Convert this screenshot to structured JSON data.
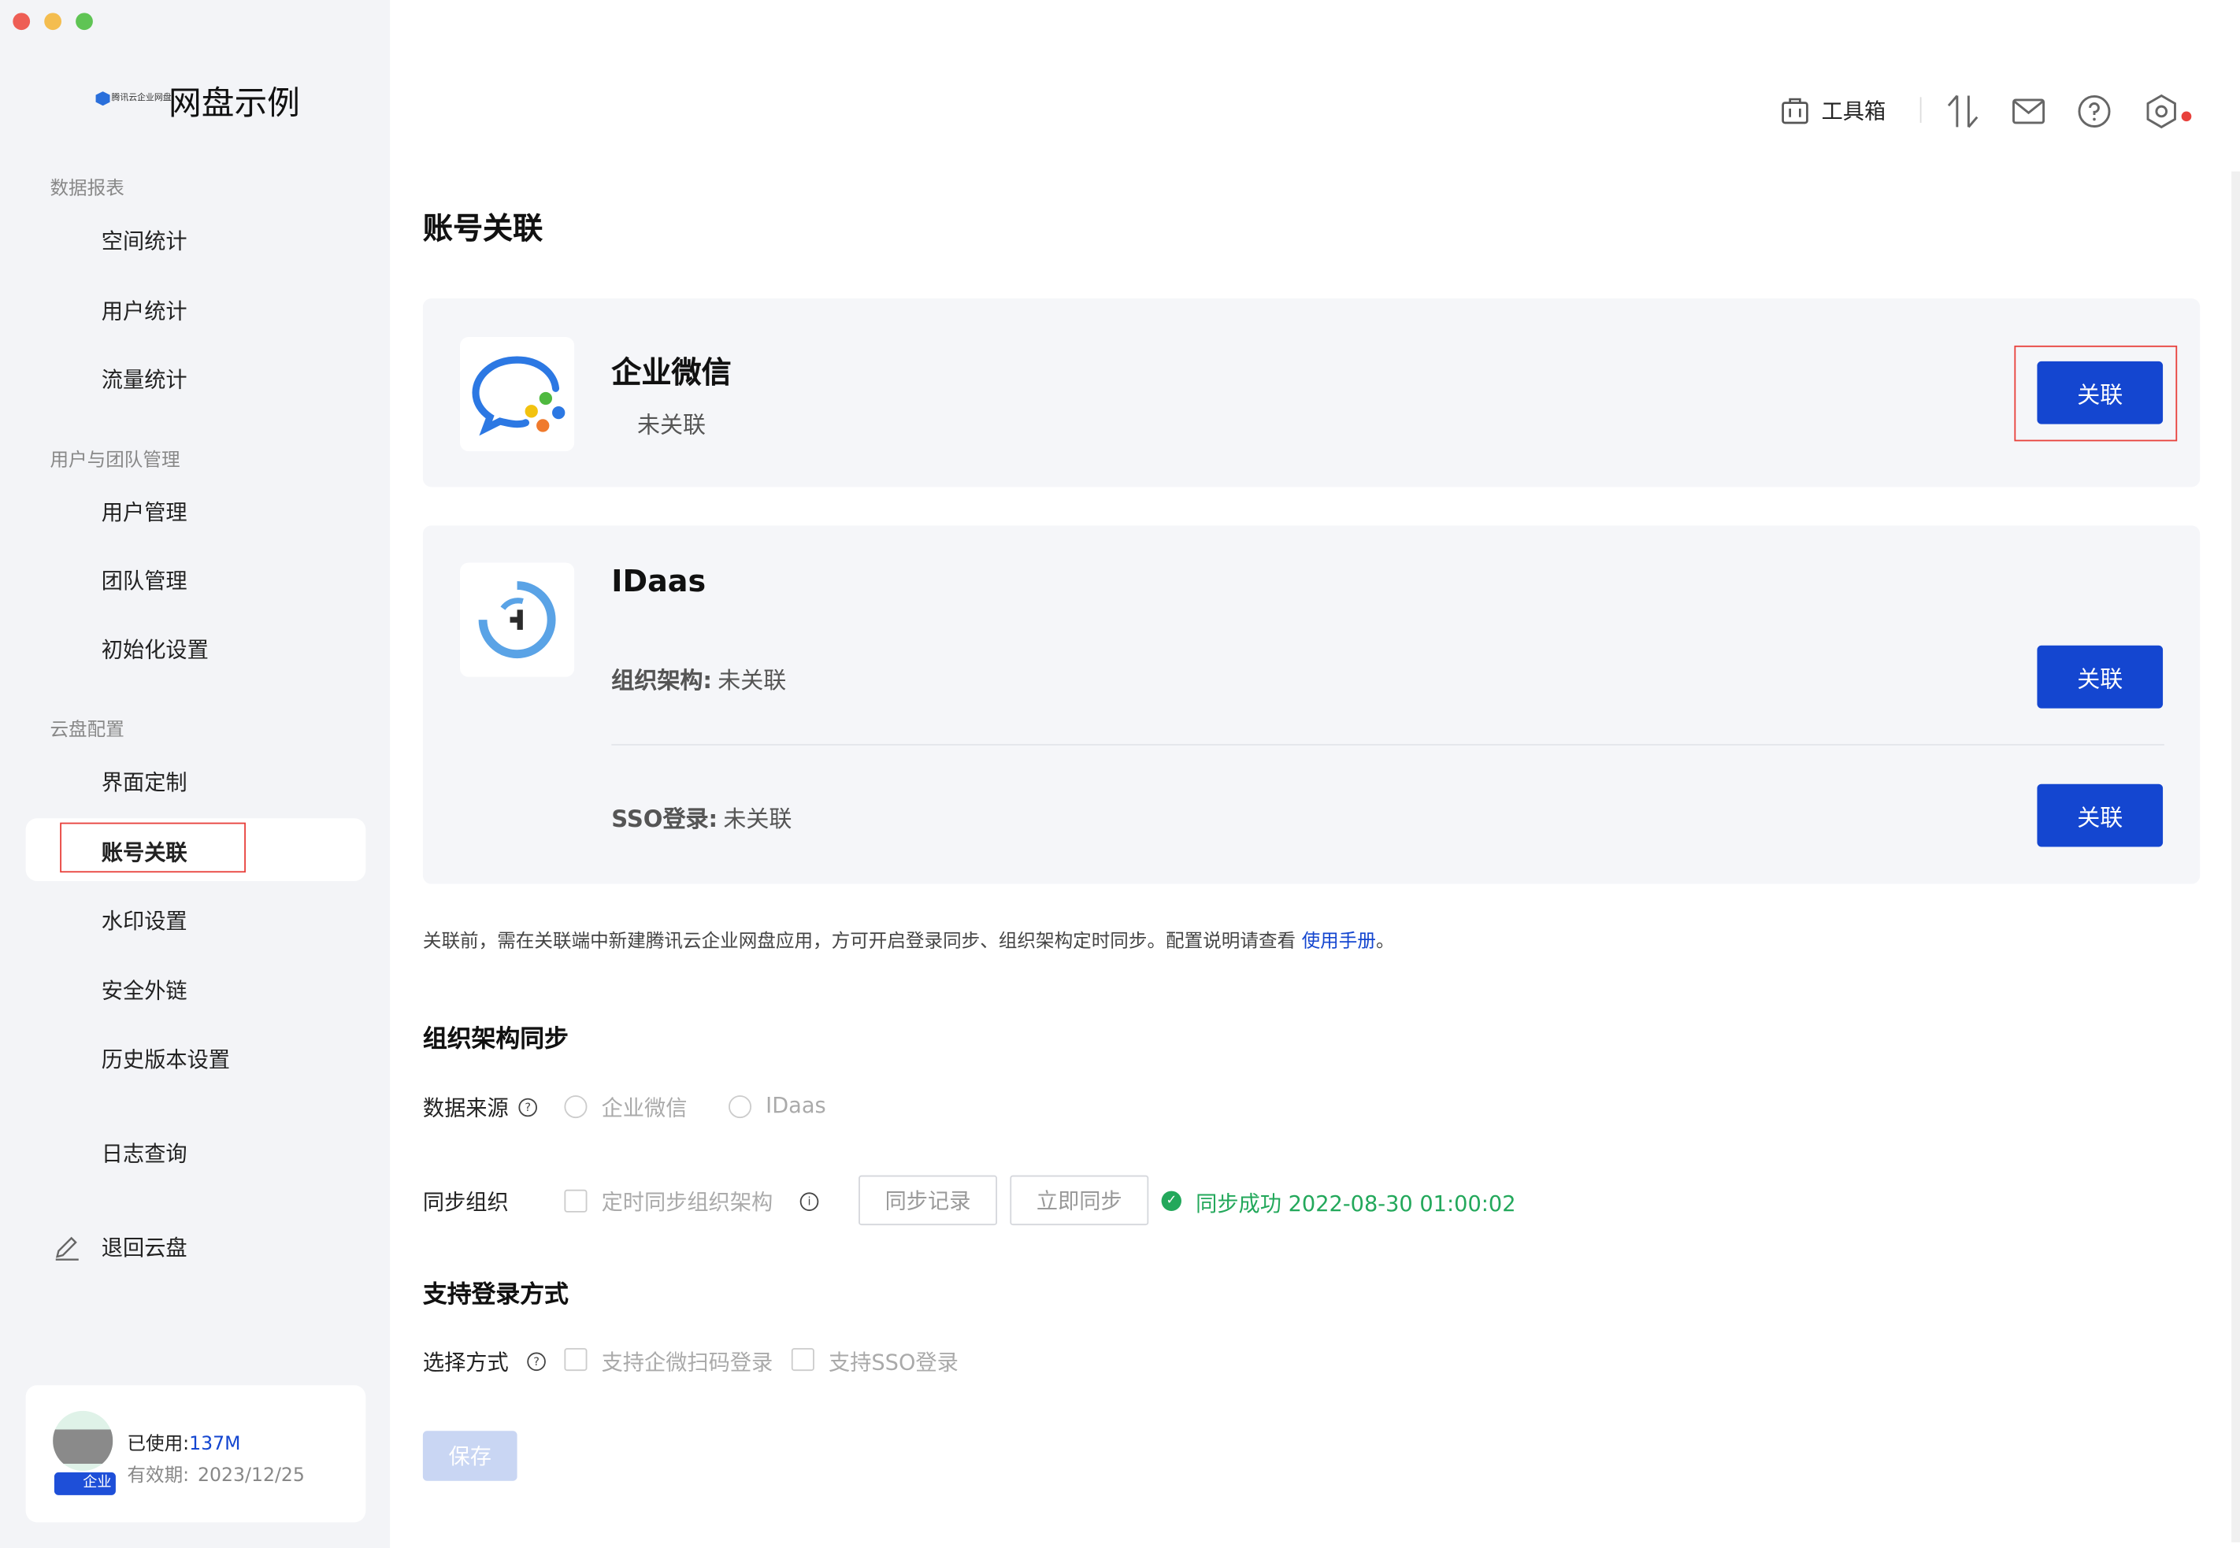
{
  "window": {
    "traffic_lights": [
      "#ee5e55",
      "#f4bd4f",
      "#5fc454"
    ]
  },
  "brand": {
    "logo_text": "腾讯云企业网盘",
    "title": "网盘示例"
  },
  "sidebar": {
    "groups": [
      {
        "label": "数据报表",
        "items": [
          "空间统计",
          "用户统计",
          "流量统计"
        ]
      },
      {
        "label": "用户与团队管理",
        "items": [
          "用户管理",
          "团队管理",
          "初始化设置"
        ]
      },
      {
        "label": "云盘配置",
        "items": [
          "界面定制",
          "账号关联",
          "水印设置",
          "安全外链",
          "历史版本设置"
        ]
      }
    ],
    "log_query": "日志查询",
    "back_to_drive": "退回云盘",
    "active_item": "账号关联",
    "usage": {
      "used_label": "已使用:",
      "used_value": "137M",
      "expiry_label": "有效期:",
      "expiry_value": "2023/12/25",
      "badge": "企业"
    }
  },
  "toolbar": {
    "toolbox_label": "工具箱",
    "icons": [
      "toolbox-icon",
      "transfer-icon",
      "mail-icon",
      "help-icon",
      "settings-icon"
    ],
    "notification_color": "#e8413c"
  },
  "page": {
    "title": "账号关联"
  },
  "wecom": {
    "name": "企业微信",
    "status": "未关联",
    "button": "关联"
  },
  "idaas": {
    "name": "IDaas",
    "org_label": "组织架构:",
    "org_status": "未关联",
    "org_button": "关联",
    "sso_label": "SSO登录:",
    "sso_status": "未关联",
    "sso_button": "关联"
  },
  "notice": {
    "text": "关联前，需在关联端中新建腾讯云企业网盘应用，方可开启登录同步、组织架构定时同步。配置说明请查看 ",
    "link": "使用手册",
    "end": "。"
  },
  "org_sync": {
    "title": "组织架构同步",
    "source_label": "数据来源",
    "source_options": [
      "企业微信",
      "IDaas"
    ],
    "sync_label": "同步组织",
    "scheduled_option": "定时同步组织架构",
    "records_button": "同步记录",
    "sync_now_button": "立即同步",
    "sync_status": "同步成功 2022-08-30 01:00:02"
  },
  "login": {
    "title": "支持登录方式",
    "method_label": "选择方式",
    "options": [
      "支持企微扫码登录",
      "支持SSO登录"
    ]
  },
  "save_button": "保存",
  "colors": {
    "primary": "#1446d0",
    "success": "#23a85b",
    "highlight": "#e8413c"
  }
}
